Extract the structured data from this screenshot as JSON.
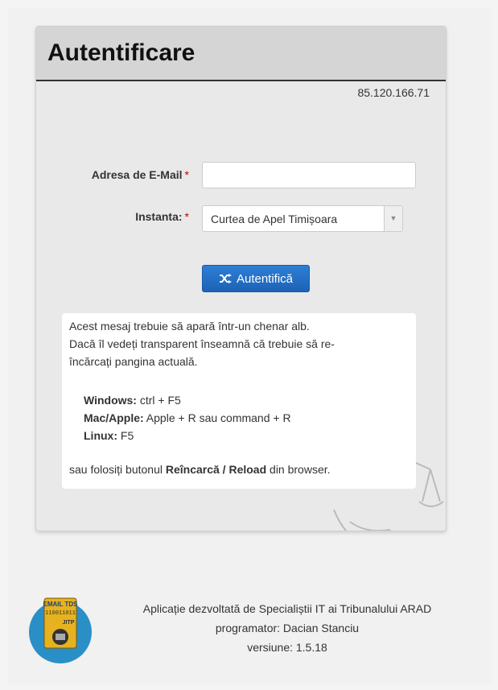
{
  "panel": {
    "title": "Autentificare",
    "ip": "85.120.166.71"
  },
  "form": {
    "email_label": "Adresa de E-Mail",
    "email_value": "",
    "instanta_label": "Instanta:",
    "required_mark": "*",
    "instanta_value": "Curtea de Apel Timișoara",
    "arrow": "▼",
    "button_label": "Autentifică",
    "button_icon": "shuffle-icon"
  },
  "message": {
    "line1": "Acest mesaj trebuie să apară într-un chenar alb.",
    "line2": "Dacă îl vedeți transparent înseamnă că trebuie să re-",
    "line3": "încărcați pangina actuală.",
    "windows_key": "Windows:",
    "windows_val": " ctrl + F5",
    "mac_key": "Mac/Apple:",
    "mac_val": " Apple + R sau command + R",
    "linux_key": "Linux:",
    "linux_val": " F5",
    "tail_pre": "sau folosiți butonul ",
    "tail_bold": "Reîncarcă / Reload",
    "tail_post": " din browser."
  },
  "footer": {
    "line1": "Aplicație dezvoltată de Specialiștii IT ai Tribunalului ARAD",
    "line2": "programator: Dacian Stanciu",
    "line3": "versiune: 1.5.18",
    "logo_text_top": "EMAIL TDS",
    "logo_text_mid": "110011011",
    "logo_text_jitp": "JITP"
  },
  "colors": {
    "accent": "#1d62b6",
    "required": "#cc0000"
  }
}
